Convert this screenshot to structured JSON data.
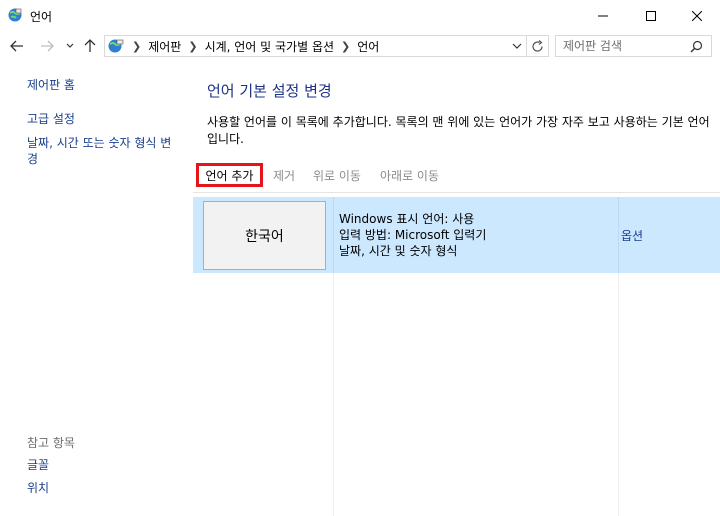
{
  "window": {
    "title": "언어",
    "minimize_label": "최소화",
    "maximize_label": "최대화",
    "close_label": "닫기"
  },
  "address_bar": {
    "crumbs": [
      "제어판",
      "시계, 언어 및 국가별 옵션",
      "언어"
    ],
    "search_placeholder": "제어판 검색"
  },
  "left_nav": {
    "home": "제어판 홈",
    "advanced": "고급 설정",
    "date_time": "날짜, 시간 또는 숫자 형식 변경",
    "see_also_heading": "참고 항목",
    "fonts": "글꼴",
    "location": "위치"
  },
  "main": {
    "title": "언어 기본 설정 변경",
    "description": "사용할 언어를 이 목록에 추가합니다. 목록의 맨 위에 있는 언어가 가장 자주 보고 사용하는 기본 언어입니다.",
    "toolbar": {
      "add": "언어 추가",
      "remove": "제거",
      "move_up": "위로 이동",
      "move_down": "아래로 이동"
    },
    "languages": [
      {
        "name": "한국어",
        "details": [
          "Windows 표시 언어: 사용",
          "입력 방법: Microsoft 입력기",
          "날짜, 시간 및 숫자 형식"
        ],
        "options": "옵션"
      }
    ]
  },
  "colors": {
    "link": "#1a3e8c",
    "title": "#1e3287",
    "selection": "#cce8ff",
    "highlight_border": "#e3141b"
  },
  "icons": [
    "control-panel-icon",
    "back-arrow-icon",
    "forward-arrow-icon",
    "chevron-down-icon",
    "up-arrow-icon",
    "refresh-icon",
    "search-icon"
  ]
}
